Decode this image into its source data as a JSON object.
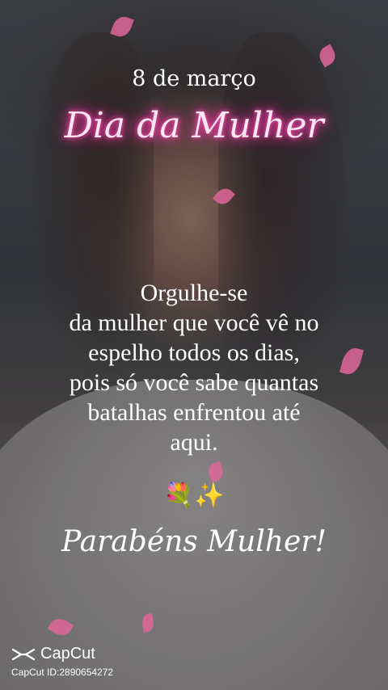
{
  "header": {
    "date": "8 de março",
    "title": "Dia da Mulher"
  },
  "message": {
    "lines": [
      "Orgulhe-se",
      "da mulher que você vê no",
      "espelho todos os dias,",
      "pois só você sabe quantas",
      "batalhas enfrentou até",
      "aqui."
    ]
  },
  "emoji": "💐✨",
  "closing": "Parabéns Mulher!",
  "watermark": {
    "brand": "CapCut",
    "id": "CapCut ID:2890654272"
  },
  "colors": {
    "neon_pink": "#ff3aa8",
    "petal": "#e0669a",
    "text": "#ffffff"
  }
}
